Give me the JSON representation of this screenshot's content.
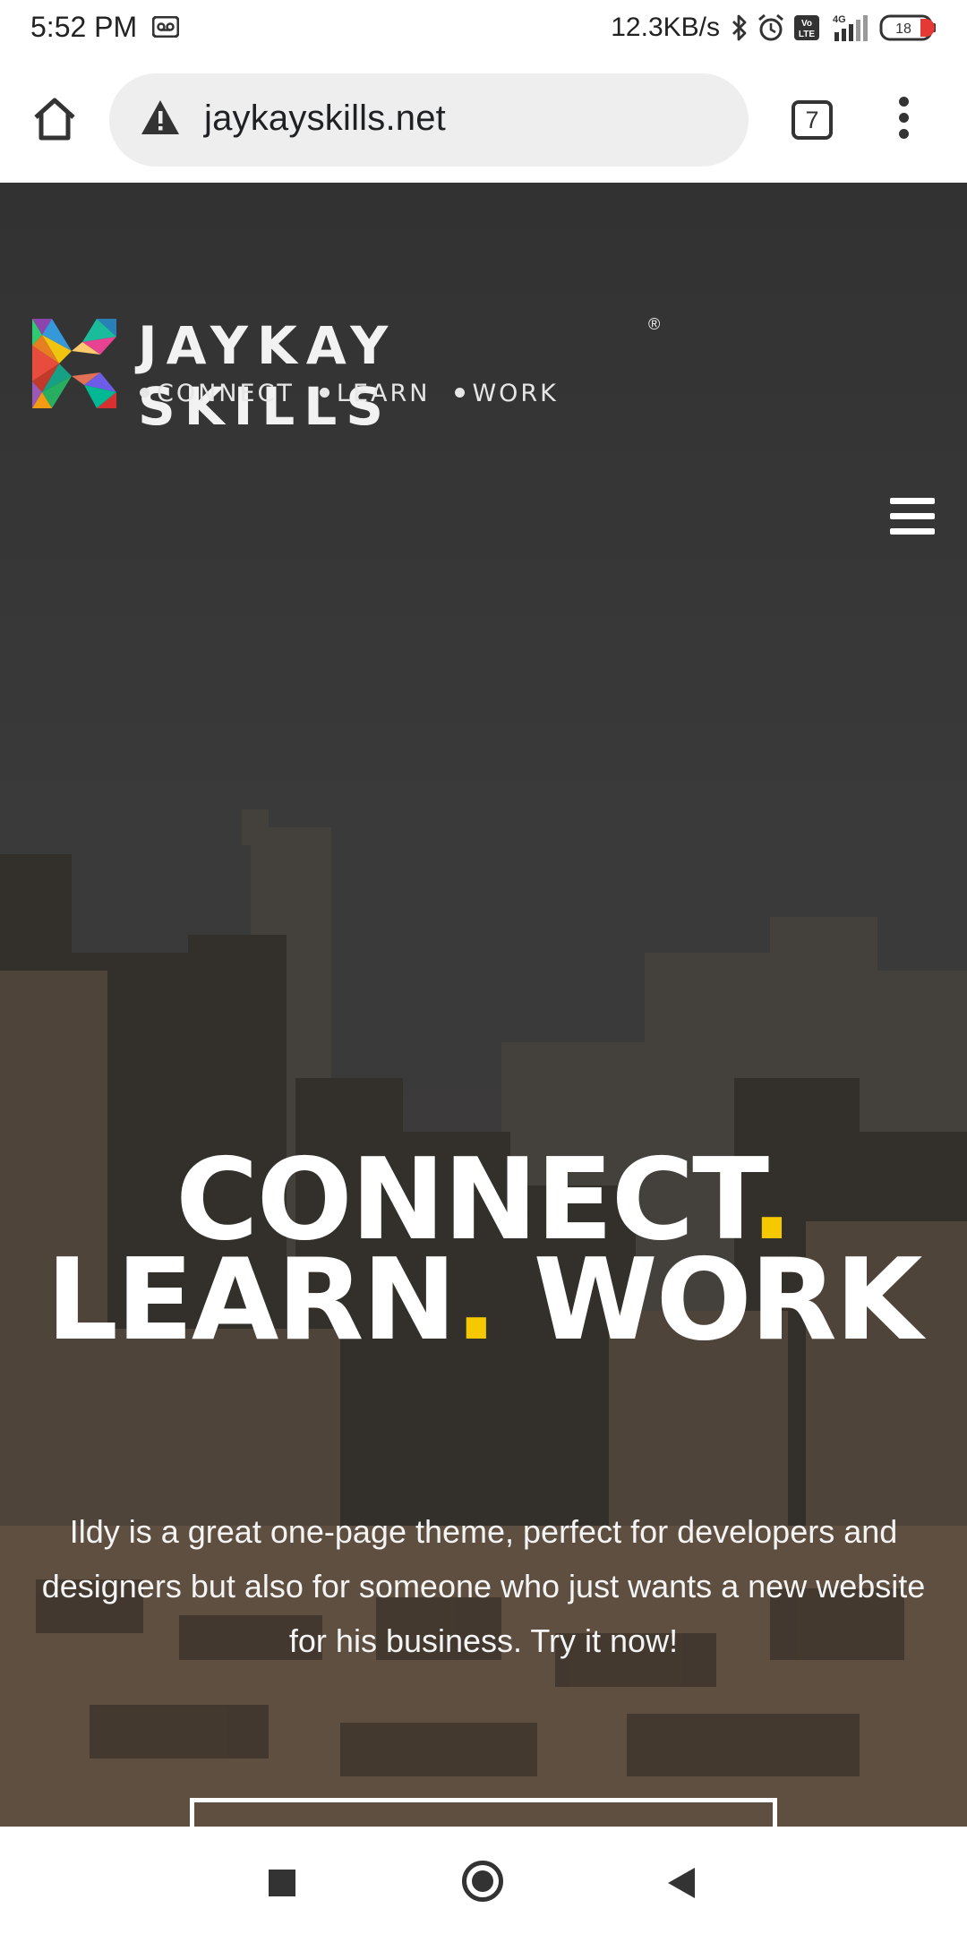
{
  "status_bar": {
    "time": "5:52 PM",
    "net_speed": "12.3KB/s",
    "battery": "18",
    "network": "4G",
    "icons": [
      "voicemail-icon",
      "bluetooth-icon",
      "alarm-icon",
      "volte-icon",
      "signal-icon",
      "battery-icon"
    ]
  },
  "browser": {
    "url": "jaykayskills.net",
    "tab_count": "7",
    "icons": [
      "home-icon",
      "warning-icon",
      "tabs-icon",
      "more-vert-icon"
    ]
  },
  "hero": {
    "logo_title": "JAYKAY SKILLS",
    "logo_registered": "®",
    "logo_tagline": [
      "CONNECT",
      "LEARN",
      "WORK"
    ],
    "headline_line1": "CONNECT",
    "headline_line2a": "LEARN",
    "headline_line2b": " WORK",
    "headline_dot": ".",
    "description": "Ildy is a great one-page theme, perfect for developers and designers but also for someone who just wants a new website for his business. Try it now!",
    "accent_color": "#f5c800"
  },
  "nav_bar": {
    "icons": [
      "recents-icon",
      "home-icon",
      "back-icon"
    ]
  }
}
